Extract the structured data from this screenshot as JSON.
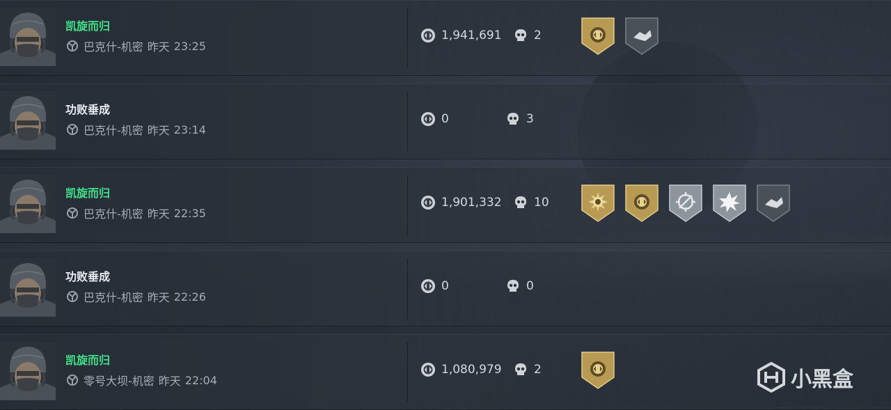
{
  "matches": [
    {
      "result": "凯旋而归",
      "status": "win",
      "map": "巴克什-机密",
      "day": "昨天",
      "time": "23:25",
      "money": "1,941,691",
      "kills": "2",
      "medals": [
        "gold-emblem",
        "gray-hand"
      ]
    },
    {
      "result": "功败垂成",
      "status": "lose",
      "map": "巴克什-机密",
      "day": "昨天",
      "time": "23:14",
      "money": "0",
      "kills": "3",
      "medals": []
    },
    {
      "result": "凯旋而归",
      "status": "win",
      "map": "巴克什-机密",
      "day": "昨天",
      "time": "22:35",
      "money": "1,901,332",
      "kills": "10",
      "medals": [
        "gold-sun",
        "gold-emblem",
        "silver-reticle",
        "silver-burst",
        "gray-hand"
      ]
    },
    {
      "result": "功败垂成",
      "status": "lose",
      "map": "巴克什-机密",
      "day": "昨天",
      "time": "22:26",
      "money": "0",
      "kills": "0",
      "medals": []
    },
    {
      "result": "凯旋而归",
      "status": "win",
      "map": "零号大坝-机密",
      "day": "昨天",
      "time": "22:04",
      "money": "1,080,979",
      "kills": "2",
      "medals": [
        "gold-emblem"
      ]
    }
  ],
  "watermark": {
    "text": "小黑盒"
  },
  "colors": {
    "win": "#3ee089",
    "lose": "#e8ecf0",
    "gold": "#b89a54",
    "silver": "#8d959c",
    "gray": "#4a5057"
  }
}
